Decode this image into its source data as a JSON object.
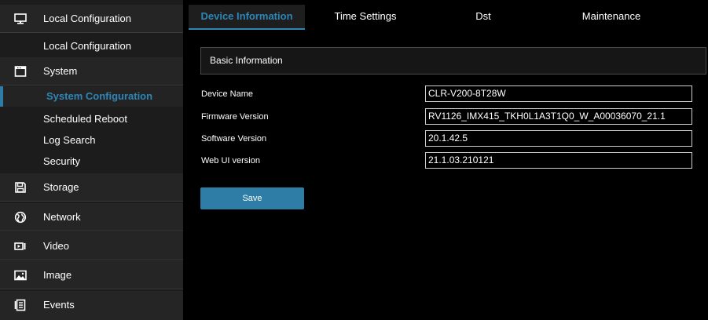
{
  "sidebar": {
    "local_configuration": {
      "label": "Local Configuration",
      "icon": "monitor-icon"
    },
    "local_configuration_sub": "Local Configuration",
    "system": {
      "label": "System",
      "icon": "system-icon"
    },
    "system_items": [
      {
        "label": "System Configuration",
        "active": true
      },
      {
        "label": "Scheduled Reboot"
      },
      {
        "label": "Log Search"
      },
      {
        "label": "Security"
      }
    ],
    "storage": {
      "label": "Storage",
      "icon": "floppy-disk-icon"
    },
    "network": {
      "label": "Network",
      "icon": "globe-icon"
    },
    "video": {
      "label": "Video",
      "icon": "video-icon"
    },
    "image": {
      "label": "Image",
      "icon": "image-icon"
    },
    "events": {
      "label": "Events",
      "icon": "events-icon"
    }
  },
  "tabs": [
    {
      "label": "Device Information",
      "active": true
    },
    {
      "label": "Time Settings"
    },
    {
      "label": "Dst"
    },
    {
      "label": "Maintenance"
    }
  ],
  "section_title": "Basic Information",
  "fields": {
    "device_name": {
      "label": "Device Name",
      "value": "CLR-V200-8T28W"
    },
    "firmware_version": {
      "label": "Firmware Version",
      "value": "RV1126_IMX415_TKH0L1A3T1Q0_W_A00036070_21.1"
    },
    "software_version": {
      "label": "Software Version",
      "value": "20.1.42.5"
    },
    "web_ui_version": {
      "label": "Web UI version",
      "value": "21.1.03.210121"
    }
  },
  "save_label": "Save",
  "colors": {
    "accent": "#2e7da6",
    "sidebar_bg": "#1c1c1c",
    "section_bg": "#252525",
    "page_bg": "#000000"
  }
}
